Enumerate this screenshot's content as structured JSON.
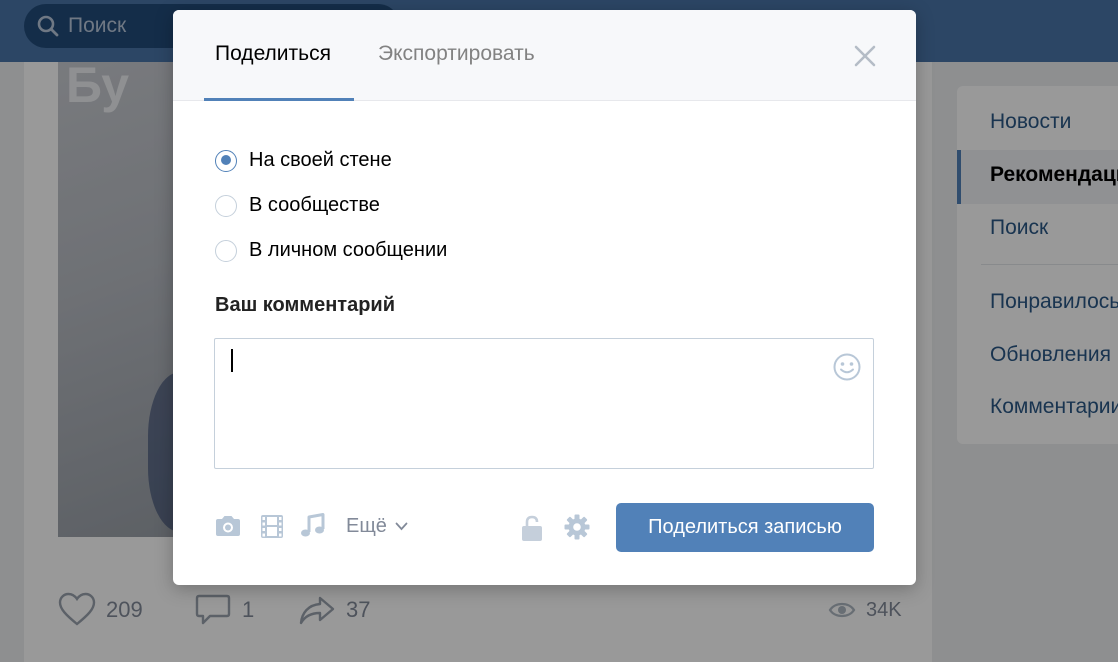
{
  "background": {
    "search_placeholder": "Поиск",
    "post_image_text": "Бу",
    "stats": {
      "likes": "209",
      "comments": "1",
      "shares": "37",
      "views": "34K"
    },
    "right_menu": [
      {
        "label": "Новости",
        "active": false
      },
      {
        "label": "Рекомендации",
        "active": true
      },
      {
        "label": "Поиск",
        "active": false
      },
      {
        "label": "Понравилось",
        "active": false
      },
      {
        "label": "Обновления",
        "active": false
      },
      {
        "label": "Комментарии",
        "active": false
      }
    ]
  },
  "dialog": {
    "tabs": [
      {
        "label": "Поделиться",
        "active": true
      },
      {
        "label": "Экспортировать",
        "active": false
      }
    ],
    "share_targets": [
      {
        "label": "На своей стене",
        "checked": true
      },
      {
        "label": "В сообществе",
        "checked": false
      },
      {
        "label": "В личном сообщении",
        "checked": false
      }
    ],
    "comment_label": "Ваш комментарий",
    "comment_value": "",
    "attach_icons": [
      "camera-icon",
      "video-icon",
      "music-icon"
    ],
    "more_label": "Ещё",
    "share_button_label": "Поделиться записью"
  },
  "colors": {
    "accent": "#5181b8",
    "header": "#4a76a8",
    "icon_gray": "#b8c7d7",
    "muted_text": "#828a99"
  }
}
